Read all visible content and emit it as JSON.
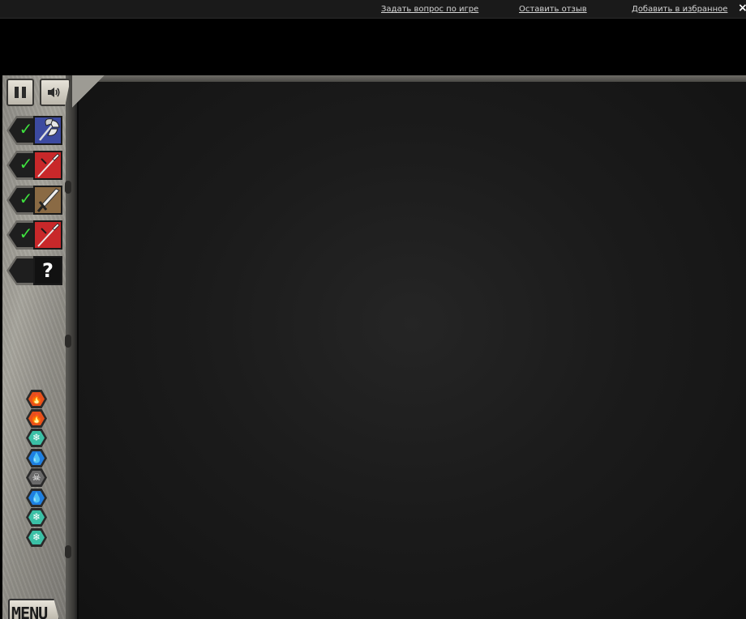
{
  "header": {
    "links": [
      "Задать вопрос по игре",
      "Оставить отзыв",
      "Добавить в избранное"
    ],
    "close_label": "×"
  },
  "controls": {
    "pause_icon": "pause-icon",
    "sound_icon": "speaker-icon"
  },
  "units": [
    {
      "status": "ready",
      "check": "✓",
      "icon": "battle-axe-icon",
      "bg": "#3c4aa0"
    },
    {
      "status": "ready",
      "check": "✓",
      "icon": "spear-icon",
      "bg": "#c8282a"
    },
    {
      "status": "ready",
      "check": "✓",
      "icon": "sword-icon",
      "bg": "#8a6a44"
    },
    {
      "status": "ready",
      "check": "✓",
      "icon": "spear-icon",
      "bg": "#c8282a"
    },
    {
      "status": "locked",
      "label": "?",
      "icon": "question-mark-icon",
      "bg": "#111111"
    }
  ],
  "elements": [
    {
      "type": "fire",
      "glyph": "🔥",
      "color": "#e8501a"
    },
    {
      "type": "fire",
      "glyph": "🔥",
      "color": "#e8501a"
    },
    {
      "type": "ice",
      "glyph": "❄",
      "color": "#3bc0a6"
    },
    {
      "type": "water",
      "glyph": "💧",
      "color": "#1e7fe0"
    },
    {
      "type": "death",
      "glyph": "☠",
      "color": "#6a6a6a"
    },
    {
      "type": "water",
      "glyph": "💧",
      "color": "#1e7fe0"
    },
    {
      "type": "ice",
      "glyph": "❄",
      "color": "#3bc0a6"
    },
    {
      "type": "ice",
      "glyph": "❄",
      "color": "#3bc0a6"
    }
  ],
  "menu": {
    "label": "MENU"
  }
}
